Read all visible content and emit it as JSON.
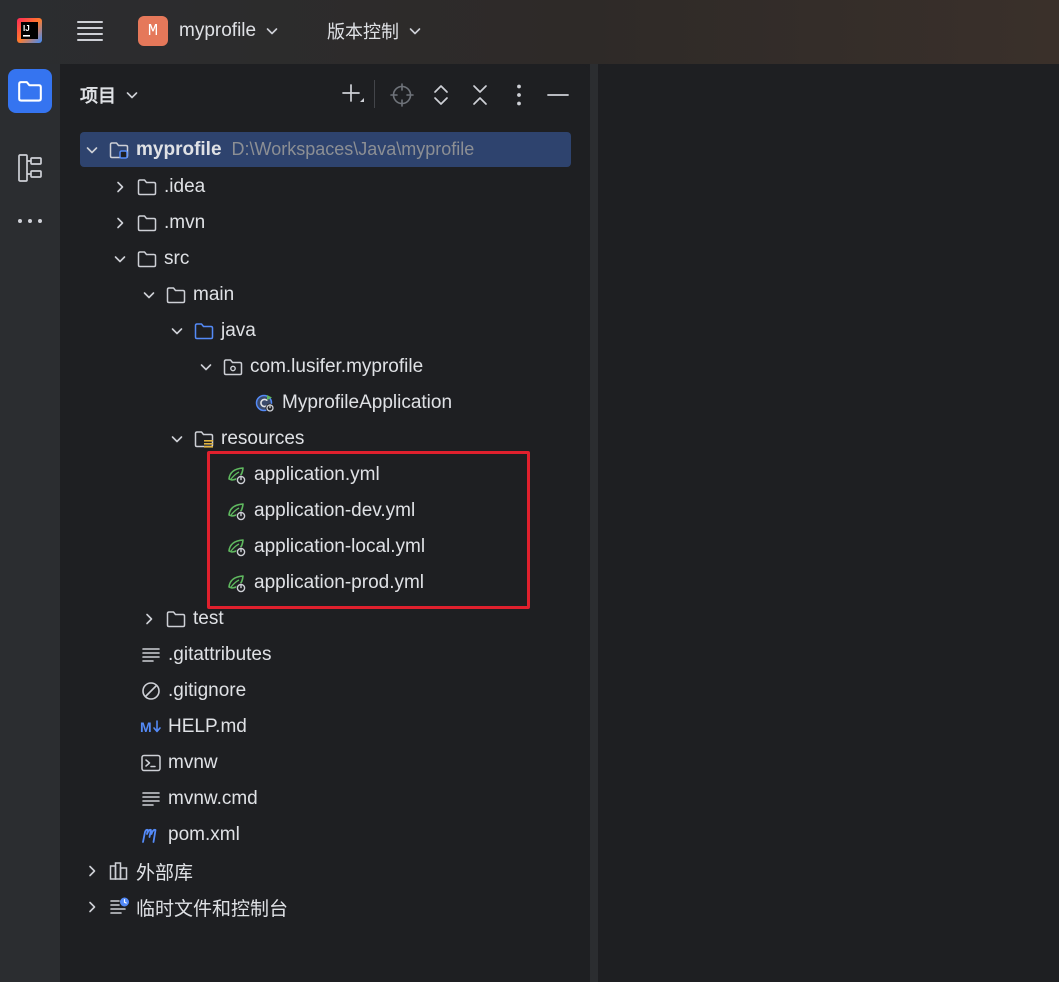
{
  "titlebar": {
    "project_initial": "M",
    "project_name": "myprofile",
    "vcs_label": "版本控制"
  },
  "panel": {
    "title": "项目"
  },
  "tree": {
    "root": {
      "label": "myprofile",
      "path": "D:\\Workspaces\\Java\\myprofile"
    },
    "idea": ".idea",
    "mvn": ".mvn",
    "src": "src",
    "main": "main",
    "java": "java",
    "package": "com.lusifer.myprofile",
    "app_class": "MyprofileApplication",
    "resources": "resources",
    "yml_files": [
      "application.yml",
      "application-dev.yml",
      "application-local.yml",
      "application-prod.yml"
    ],
    "test": "test",
    "gitattributes": ".gitattributes",
    "gitignore": ".gitignore",
    "help_md": "HELP.md",
    "mvnw": "mvnw",
    "mvnw_cmd": "mvnw.cmd",
    "pom": "pom.xml",
    "external_libs": "外部库",
    "scratches": "临时文件和控制台"
  },
  "colors": {
    "accent": "#3574f0",
    "selection": "#2e436e",
    "highlight_box": "#e0202d",
    "spring_leaf": "#5fb85f",
    "avatar": "#e5785a"
  }
}
